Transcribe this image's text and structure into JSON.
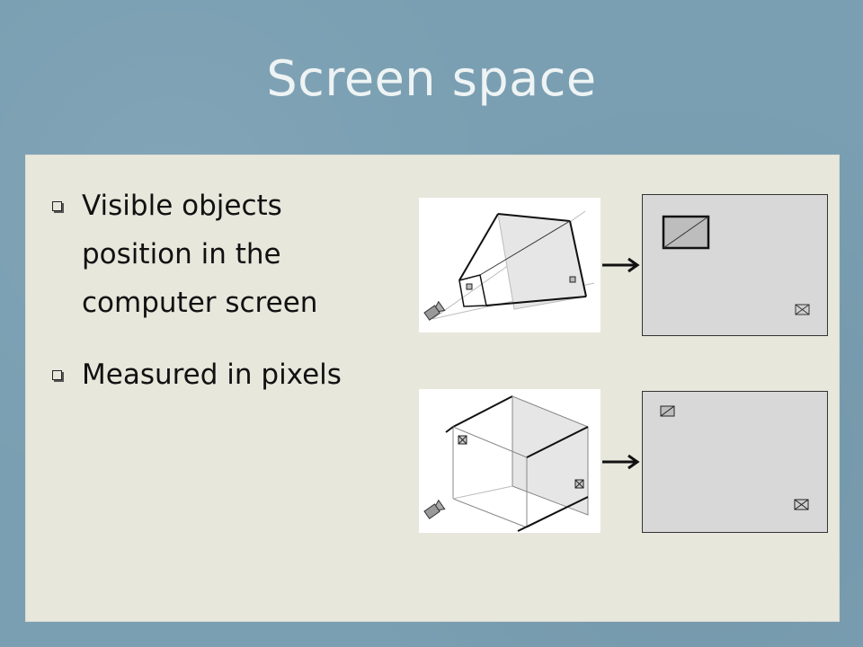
{
  "slide": {
    "title": "Screen space",
    "bullets": [
      {
        "lines": [
          "Visible objects",
          "position in the",
          "computer screen"
        ]
      },
      {
        "lines": [
          "Measured in pixels"
        ]
      }
    ]
  },
  "colors": {
    "background": "#7a9fb2",
    "panel": "#e7e7dc",
    "title": "#eef3f4",
    "screen_fill": "#d8d8d8"
  },
  "icons": {
    "bullet": "hollow-square-bullet",
    "camera": "camera-icon",
    "arrow": "right-arrow"
  }
}
